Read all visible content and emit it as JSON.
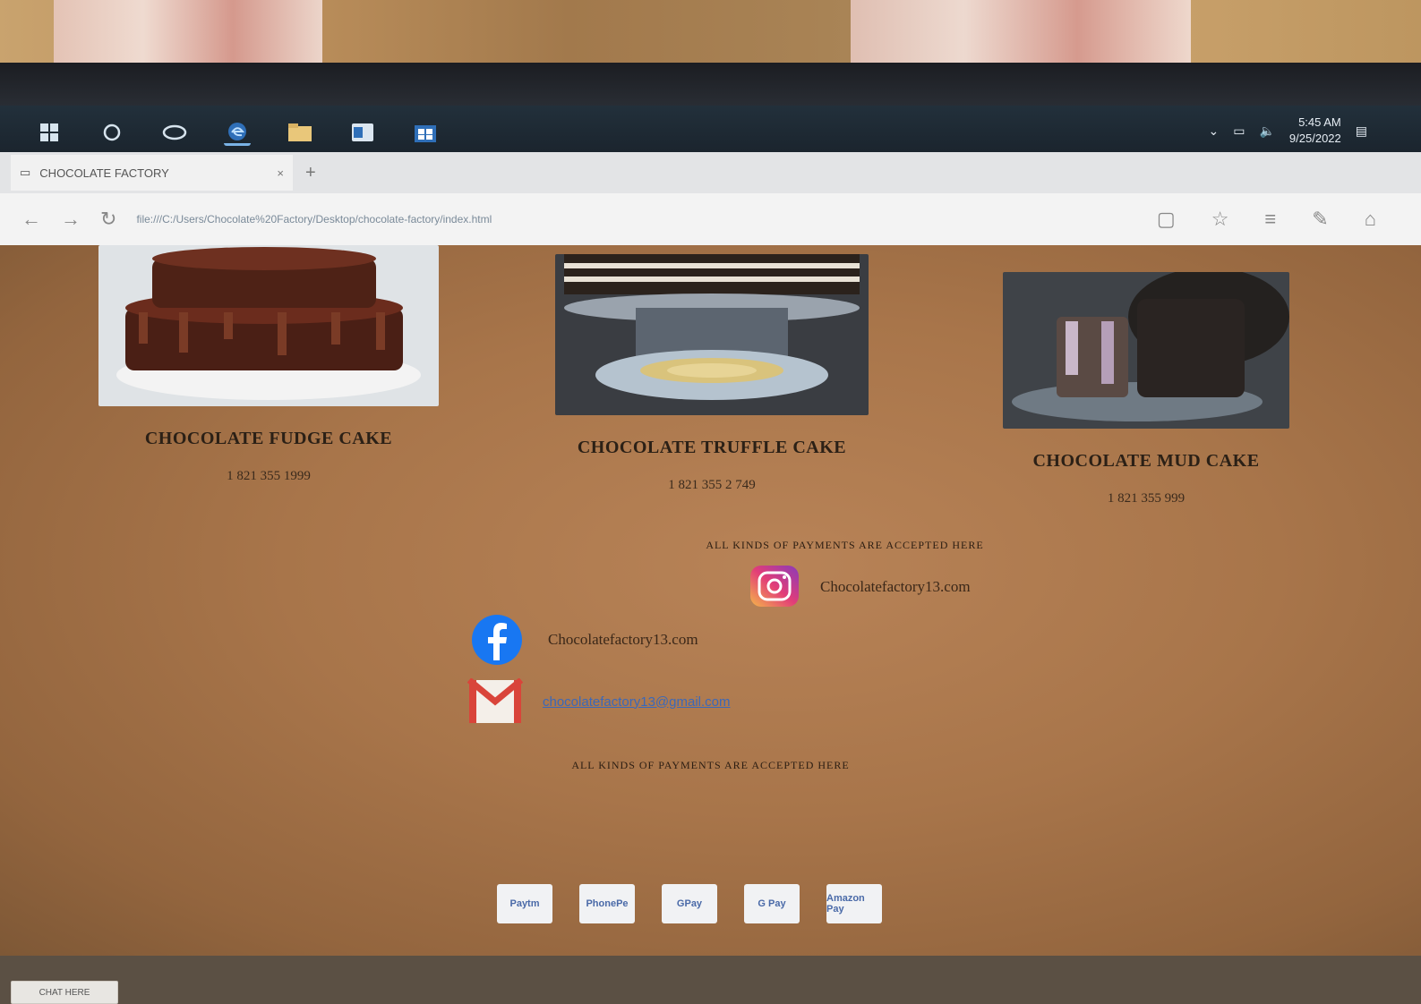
{
  "browser": {
    "tab_title": "CHOCOLATE FACTORY",
    "url": "file:///C:/Users/Chocolate%20Factory/Desktop/chocolate-factory/index.html"
  },
  "taskbar": {
    "time": "5:45 AM",
    "date": "9/25/2022"
  },
  "cakes": [
    {
      "name": "CHOCOLATE FUDGE CAKE",
      "phone": "1 821 355 1999"
    },
    {
      "name": "CHOCOLATE TRUFFLE CAKE",
      "phone": "1 821 355 2 749"
    },
    {
      "name": "CHOCOLATE MUD CAKE",
      "phone": "1 821 355 999"
    }
  ],
  "payment_text_top": "ALL KINDS OF PAYMENTS ARE ACCEPTED HERE",
  "payment_text_bottom": "ALL KINDS OF PAYMENTS ARE ACCEPTED HERE",
  "social": {
    "instagram": "Chocolatefactory13.com",
    "facebook": "Chocolatefactory13.com",
    "email": "chocolatefactory13@gmail.com"
  },
  "payments": [
    "Paytm",
    "PhonePe",
    "GPay",
    "G Pay",
    "Amazon Pay"
  ],
  "chat_button": "CHAT HERE"
}
